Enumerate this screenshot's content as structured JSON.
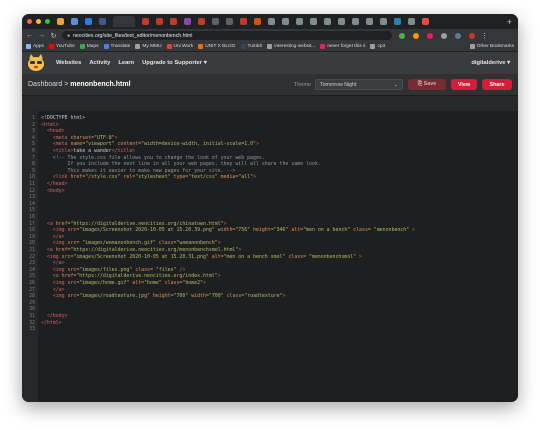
{
  "browser": {
    "url": "neocities.org/site_files/text_editor/menonbench.html",
    "bookmarks": [
      {
        "label": "Apps",
        "color": "#8ab4f8"
      },
      {
        "label": "YouTube",
        "color": "#ff0000"
      },
      {
        "label": "Maps",
        "color": "#34a853"
      },
      {
        "label": "Translate",
        "color": "#4285f4"
      },
      {
        "label": "My MMU",
        "color": "#9aa0a6"
      },
      {
        "label": "Uni Work",
        "color": "#db4437"
      },
      {
        "label": "UNIT X BLOG",
        "color": "#e37400"
      },
      {
        "label": "Tumblr",
        "color": "#35465c"
      },
      {
        "label": "interesting websit...",
        "color": "#9aa0a6"
      },
      {
        "label": "never forget this s",
        "color": "#e91e63"
      },
      {
        "label": "cp3",
        "color": "#9aa0a6"
      }
    ],
    "other_bookmarks": "Other Bookmarks"
  },
  "site": {
    "nav": [
      "Websites",
      "Activity",
      "Learn",
      "Upgrade to Supporter ♥"
    ],
    "username": "digitalderive ▾"
  },
  "editor": {
    "breadcrumb_root": "Dashboard",
    "breadcrumb_sep": " > ",
    "filename": "menonbench.html",
    "theme_label": "Theme",
    "theme_value": "Tomorrow Night",
    "save_label": "⎘ Save",
    "view_label": "View",
    "share_label": "Share"
  },
  "code_lines": [
    [
      {
        "t": "doc",
        "v": "<!DOCTYPE html>"
      }
    ],
    [
      {
        "t": "tag",
        "v": "<html>"
      }
    ],
    [
      {
        "t": "txt",
        "v": "  "
      },
      {
        "t": "tag",
        "v": "<head>"
      }
    ],
    [
      {
        "t": "txt",
        "v": "    "
      },
      {
        "t": "tag",
        "v": "<meta "
      },
      {
        "t": "attr",
        "v": "charset="
      },
      {
        "t": "str",
        "v": "\"UTF-8\""
      },
      {
        "t": "tag",
        "v": ">"
      }
    ],
    [
      {
        "t": "txt",
        "v": "    "
      },
      {
        "t": "tag",
        "v": "<meta "
      },
      {
        "t": "attr",
        "v": "name="
      },
      {
        "t": "str",
        "v": "\"viewport\" "
      },
      {
        "t": "attr",
        "v": "content="
      },
      {
        "t": "str",
        "v": "\"width=device-width, initial-scale=1.0\""
      },
      {
        "t": "tag",
        "v": ">"
      }
    ],
    [
      {
        "t": "txt",
        "v": "    "
      },
      {
        "t": "tag",
        "v": "<title>"
      },
      {
        "t": "txt",
        "v": "take a wander"
      },
      {
        "t": "tag",
        "v": "</title>"
      }
    ],
    [
      {
        "t": "com",
        "v": "    <!-- The style.css file allows you to change the look of your web pages."
      }
    ],
    [
      {
        "t": "com",
        "v": "         If you include the next line in all your web pages, they will all share the same look."
      }
    ],
    [
      {
        "t": "com",
        "v": "         This makes it easier to make new pages for your site. -->"
      }
    ],
    [
      {
        "t": "txt",
        "v": "    "
      },
      {
        "t": "tag",
        "v": "<link "
      },
      {
        "t": "attr",
        "v": "href="
      },
      {
        "t": "str",
        "v": "\"/style.css\" "
      },
      {
        "t": "attr",
        "v": "rel="
      },
      {
        "t": "str",
        "v": "\"stylesheet\" "
      },
      {
        "t": "attr",
        "v": "type="
      },
      {
        "t": "str",
        "v": "\"text/css\" "
      },
      {
        "t": "attr",
        "v": "media="
      },
      {
        "t": "str",
        "v": "\"all\""
      },
      {
        "t": "tag",
        "v": ">"
      }
    ],
    [
      {
        "t": "txt",
        "v": "  "
      },
      {
        "t": "tag",
        "v": "</head>"
      }
    ],
    [
      {
        "t": "txt",
        "v": "  "
      },
      {
        "t": "tag",
        "v": "<body>"
      }
    ],
    [],
    [],
    [],
    [],
    [
      {
        "t": "txt",
        "v": "  "
      },
      {
        "t": "tag",
        "v": "<a "
      },
      {
        "t": "attr",
        "v": "href="
      },
      {
        "t": "str",
        "v": "\"https://digitalderive.neocities.org/chinatown.html\""
      },
      {
        "t": "tag",
        "v": ">"
      }
    ],
    [
      {
        "t": "txt",
        "v": "    "
      },
      {
        "t": "tag",
        "v": "<img "
      },
      {
        "t": "attr",
        "v": "src="
      },
      {
        "t": "str",
        "v": "\"images/Screenshot 2020-10-05 at 15.20.39.png\" "
      },
      {
        "t": "attr",
        "v": "width="
      },
      {
        "t": "str",
        "v": "\"756\" "
      },
      {
        "t": "attr",
        "v": "height="
      },
      {
        "t": "str",
        "v": "\"346\" "
      },
      {
        "t": "attr",
        "v": "alt="
      },
      {
        "t": "str",
        "v": "\"men on a bench\" "
      },
      {
        "t": "attr",
        "v": "class="
      },
      {
        "t": "str",
        "v": " \"menonbench\" "
      },
      {
        "t": "tag",
        "v": ">"
      }
    ],
    [
      {
        "t": "txt",
        "v": "    "
      },
      {
        "t": "tag",
        "v": "</a>"
      }
    ],
    [
      {
        "t": "txt",
        "v": "    "
      },
      {
        "t": "tag",
        "v": "<img "
      },
      {
        "t": "attr",
        "v": "src="
      },
      {
        "t": "str",
        "v": " \"images/womanonbench.gif\" "
      },
      {
        "t": "attr",
        "v": "class="
      },
      {
        "t": "str",
        "v": "\"womanonbench\""
      },
      {
        "t": "tag",
        "v": ">"
      }
    ],
    [
      {
        "t": "txt",
        "v": "  "
      },
      {
        "t": "tag",
        "v": "<a "
      },
      {
        "t": "attr",
        "v": "href="
      },
      {
        "t": "str",
        "v": "\"https://digitalderive.neocities.org/menonbenchsmol.html\""
      },
      {
        "t": "tag",
        "v": ">"
      }
    ],
    [
      {
        "t": "txt",
        "v": "  "
      },
      {
        "t": "tag",
        "v": "<img "
      },
      {
        "t": "attr",
        "v": "src="
      },
      {
        "t": "str",
        "v": "\"images/Screenshot 2020-10-05 at 15.20.31.png\" "
      },
      {
        "t": "attr",
        "v": "alt="
      },
      {
        "t": "str",
        "v": "\"men on a bench smol\" "
      },
      {
        "t": "attr",
        "v": "class="
      },
      {
        "t": "str",
        "v": " \"menonbenchsmol\" "
      },
      {
        "t": "tag",
        "v": ">"
      }
    ],
    [
      {
        "t": "txt",
        "v": "    "
      },
      {
        "t": "tag",
        "v": "</a>"
      }
    ],
    [
      {
        "t": "txt",
        "v": "    "
      },
      {
        "t": "tag",
        "v": "<img "
      },
      {
        "t": "attr",
        "v": "src="
      },
      {
        "t": "str",
        "v": "\"images/files.png\" "
      },
      {
        "t": "attr",
        "v": "class="
      },
      {
        "t": "str",
        "v": " \"files\" "
      },
      {
        "t": "tag",
        "v": "/>"
      }
    ],
    [
      {
        "t": "txt",
        "v": "    "
      },
      {
        "t": "tag",
        "v": "<a "
      },
      {
        "t": "attr",
        "v": "href="
      },
      {
        "t": "str",
        "v": "\"https://digitalderive.neocities.org/index.html\""
      },
      {
        "t": "tag",
        "v": ">"
      }
    ],
    [
      {
        "t": "txt",
        "v": "    "
      },
      {
        "t": "tag",
        "v": "<img "
      },
      {
        "t": "attr",
        "v": "src="
      },
      {
        "t": "str",
        "v": "\"images/home.gif\" "
      },
      {
        "t": "attr",
        "v": "alt="
      },
      {
        "t": "str",
        "v": "\"home\" "
      },
      {
        "t": "attr",
        "v": "class="
      },
      {
        "t": "str",
        "v": "\"home2\""
      },
      {
        "t": "tag",
        "v": ">"
      }
    ],
    [
      {
        "t": "txt",
        "v": "    "
      },
      {
        "t": "tag",
        "v": "</a>"
      }
    ],
    [
      {
        "t": "txt",
        "v": "    "
      },
      {
        "t": "tag",
        "v": "<img "
      },
      {
        "t": "attr",
        "v": "src="
      },
      {
        "t": "str",
        "v": "\"images/roadtexture.jpg\" "
      },
      {
        "t": "attr",
        "v": "height="
      },
      {
        "t": "str",
        "v": "\"700\" "
      },
      {
        "t": "attr",
        "v": "width="
      },
      {
        "t": "str",
        "v": "\"700\" "
      },
      {
        "t": "attr",
        "v": "class="
      },
      {
        "t": "str",
        "v": "\"roadtexture\""
      },
      {
        "t": "tag",
        "v": ">"
      }
    ],
    [],
    [],
    [
      {
        "t": "txt",
        "v": "  "
      },
      {
        "t": "tag",
        "v": "</body>"
      }
    ],
    [
      {
        "t": "tag",
        "v": "</html>"
      }
    ],
    []
  ],
  "colors": {
    "accent": "#d81b3a",
    "editor_bg": "#1d1f21",
    "tag": "#cc6666",
    "attr": "#de935f",
    "string": "#b5bd68",
    "comment": "#969896"
  }
}
